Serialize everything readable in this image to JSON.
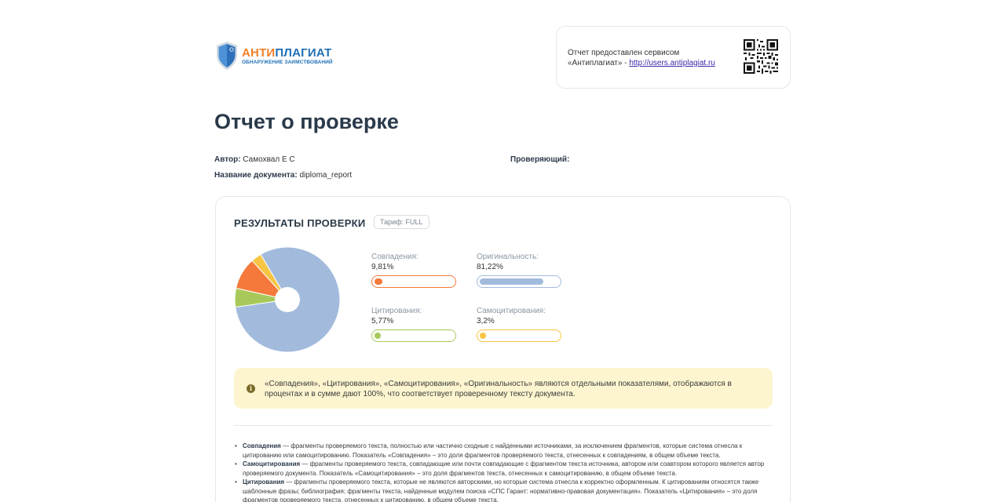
{
  "logo": {
    "part1": "АНТИ",
    "part2": "ПЛАГИАТ",
    "subtitle": "ОБНАРУЖЕНИЕ ЗАИМСТВОВАНИЙ"
  },
  "service": {
    "line1": "Отчет предоставлен сервисом",
    "line2_prefix": "«Антиплагиат» - ",
    "link": "http://users.antiplagiat.ru"
  },
  "page_title": "Отчет о проверке",
  "meta": {
    "author_label": "Автор:",
    "author": "Самохвал Е С",
    "document_label": "Название документа:",
    "document": "diploma_report",
    "reviewer_label": "Проверяющий:"
  },
  "results": {
    "title": "РЕЗУЛЬТАТЫ ПРОВЕРКИ",
    "tariff": "Тариф: FULL",
    "metrics": [
      {
        "label": "Совпадения:",
        "value": "9,81%",
        "color": "#f4793b",
        "fraction": 0.0981
      },
      {
        "label": "Оригинальность:",
        "value": "81,22%",
        "color": "#a2bbdd",
        "fraction": 0.8122
      },
      {
        "label": "Цитирования:",
        "value": "5,77%",
        "color": "#a8c95a",
        "fraction": 0.0577
      },
      {
        "label": "Самоцитирования:",
        "value": "3,2%",
        "color": "#f6c544",
        "fraction": 0.032
      }
    ],
    "notice": "«Совпадения», «Цитирования», «Самоцитирования», «Оригинальность» являются отдельными показателями, отображаются в процентах и в сумме дают 100%, что соответствует проверенному тексту документа.",
    "definitions": [
      {
        "term": "Совпадения",
        "text": " — фрагменты проверяемого текста, полностью или частично сходные с найденными источниками, за исключением фрагментов, которые система отнесла к цитированию или самоцитированию. Показатель «Совпадения» – это доля фрагментов проверяемого текста, отнесенных к совпадениям, в общем объеме текста."
      },
      {
        "term": "Самоцитирования",
        "text": " — фрагменты проверяемого текста, совпадающие или почти совпадающие с фрагментом текста источника, автором или соавтором которого является автор проверяемого документа. Показатель «Самоцитирования» – это доля фрагментов текста, отнесенных к самоцитированию, в общем объеме текста."
      },
      {
        "term": "Цитирования",
        "text": " — фрагменты проверяемого текста, которые не являются авторскими, но которые система отнесла к корректно оформленным. К цитированиям относятся также шаблонные фразы; библиография; фрагменты текста, найденные модулем поиска «СПС Гарант: нормативно-правовая документация». Показатель «Цитирования» – это доля фрагментов проверяемого текста, отнесенных к цитированию, в общем объеме текста."
      }
    ]
  }
}
